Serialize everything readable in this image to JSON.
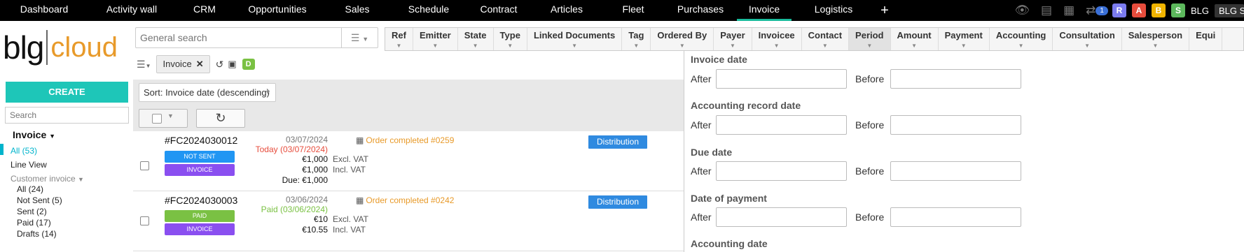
{
  "topnav": {
    "items": [
      "Dashboard",
      "Activity wall",
      "CRM",
      "Opportunities",
      "Sales",
      "Schedule",
      "Contract",
      "Articles",
      "Fleet",
      "Purchases",
      "Invoice",
      "Logistics"
    ],
    "active": "Invoice",
    "plus_label": "+",
    "notif_count": "1",
    "letters": [
      {
        "label": "R",
        "color": "#7b7bef"
      },
      {
        "label": "A",
        "color": "#e74c3c"
      },
      {
        "label": "B",
        "color": "#f0b400"
      },
      {
        "label": "S",
        "color": "#5cb85c"
      }
    ],
    "user_short": "BLG",
    "user_box": "BLG Su"
  },
  "sidebar": {
    "logo_left": "blg",
    "logo_right": "cloud",
    "create_label": "CREATE",
    "search_placeholder": "Search",
    "section_title": "Invoice",
    "all_label": "All (53)",
    "line_view": "Line View",
    "customer_invoice": "Customer invoice",
    "sub_items": [
      "All (24)",
      "Not Sent (5)",
      "Sent (2)",
      "Paid (17)",
      "Drafts (14)"
    ]
  },
  "main": {
    "search_placeholder": "General search",
    "filter_tag": "Invoice",
    "d_badge": "D",
    "sort_label": "Sort: Invoice date (descending)",
    "rows": [
      {
        "ref": "#FC2024030012",
        "pill1": "NOT SENT",
        "pill1_color": "#2196f3",
        "pill2": "INVOICE",
        "pill2_color": "#8a4ff0",
        "date": "03/07/2024",
        "status": "Today (03/07/2024)",
        "status_color": "#e74c3c",
        "excl": "€1,000",
        "excl_lbl": "Excl. VAT",
        "incl": "€1,000",
        "incl_lbl": "Incl. VAT",
        "due": "Due: €1,000",
        "order": "Order completed #0259",
        "dist": "Distribution"
      },
      {
        "ref": "#FC2024030003",
        "pill1": "PAID",
        "pill1_color": "#7ac143",
        "pill2": "INVOICE",
        "pill2_color": "#8a4ff0",
        "date": "03/06/2024",
        "status": "Paid (03/06/2024)",
        "status_color": "#7ac143",
        "excl": "€10",
        "excl_lbl": "Excl. VAT",
        "incl": "€10.55",
        "incl_lbl": "Incl. VAT",
        "order": "Order completed #0242",
        "dist": "Distribution"
      }
    ]
  },
  "columns": {
    "items": [
      "Ref",
      "Emitter",
      "State",
      "Type",
      "Linked Documents",
      "Tag",
      "Ordered By",
      "Payer",
      "Invoicee",
      "Contact",
      "Period",
      "Amount",
      "Payment",
      "Accounting",
      "Consultation",
      "Salesperson",
      "Equi"
    ],
    "active": "Period"
  },
  "filter": {
    "sections": [
      {
        "title": "Invoice date",
        "after": "After",
        "before": "Before"
      },
      {
        "title": "Accounting record date",
        "after": "After",
        "before": "Before"
      },
      {
        "title": "Due date",
        "after": "After",
        "before": "Before"
      },
      {
        "title": "Date of payment",
        "after": "After",
        "before": "Before"
      },
      {
        "title": "Accounting date"
      }
    ]
  }
}
